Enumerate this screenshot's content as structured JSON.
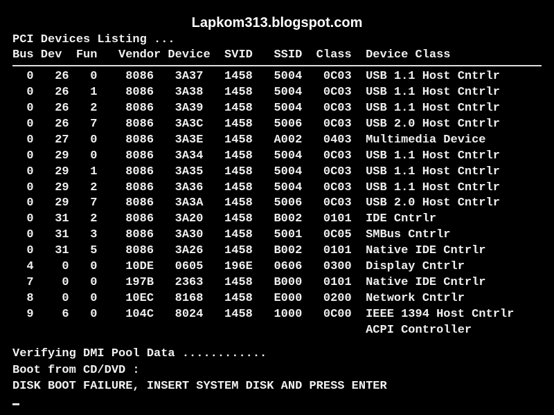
{
  "watermark": "Lapkom313.blogspot.com",
  "title": "PCI Devices Listing ...",
  "headers": {
    "bus": "Bus",
    "dev": "Dev",
    "fun": "Fun",
    "vendor": "Vendor",
    "device": "Device",
    "svid": "SVID",
    "ssid": "SSID",
    "class": "Class",
    "deviceClass": "Device Class"
  },
  "rows": [
    {
      "bus": "0",
      "dev": "26",
      "fun": "0",
      "vendor": "8086",
      "device": "3A37",
      "svid": "1458",
      "ssid": "5004",
      "class": "0C03",
      "deviceClass": "USB 1.1 Host Cntrlr"
    },
    {
      "bus": "0",
      "dev": "26",
      "fun": "1",
      "vendor": "8086",
      "device": "3A38",
      "svid": "1458",
      "ssid": "5004",
      "class": "0C03",
      "deviceClass": "USB 1.1 Host Cntrlr"
    },
    {
      "bus": "0",
      "dev": "26",
      "fun": "2",
      "vendor": "8086",
      "device": "3A39",
      "svid": "1458",
      "ssid": "5004",
      "class": "0C03",
      "deviceClass": "USB 1.1 Host Cntrlr"
    },
    {
      "bus": "0",
      "dev": "26",
      "fun": "7",
      "vendor": "8086",
      "device": "3A3C",
      "svid": "1458",
      "ssid": "5006",
      "class": "0C03",
      "deviceClass": "USB 2.0 Host Cntrlr"
    },
    {
      "bus": "0",
      "dev": "27",
      "fun": "0",
      "vendor": "8086",
      "device": "3A3E",
      "svid": "1458",
      "ssid": "A002",
      "class": "0403",
      "deviceClass": "Multimedia Device"
    },
    {
      "bus": "0",
      "dev": "29",
      "fun": "0",
      "vendor": "8086",
      "device": "3A34",
      "svid": "1458",
      "ssid": "5004",
      "class": "0C03",
      "deviceClass": "USB 1.1 Host Cntrlr"
    },
    {
      "bus": "0",
      "dev": "29",
      "fun": "1",
      "vendor": "8086",
      "device": "3A35",
      "svid": "1458",
      "ssid": "5004",
      "class": "0C03",
      "deviceClass": "USB 1.1 Host Cntrlr"
    },
    {
      "bus": "0",
      "dev": "29",
      "fun": "2",
      "vendor": "8086",
      "device": "3A36",
      "svid": "1458",
      "ssid": "5004",
      "class": "0C03",
      "deviceClass": "USB 1.1 Host Cntrlr"
    },
    {
      "bus": "0",
      "dev": "29",
      "fun": "7",
      "vendor": "8086",
      "device": "3A3A",
      "svid": "1458",
      "ssid": "5006",
      "class": "0C03",
      "deviceClass": "USB 2.0 Host Cntrlr"
    },
    {
      "bus": "0",
      "dev": "31",
      "fun": "2",
      "vendor": "8086",
      "device": "3A20",
      "svid": "1458",
      "ssid": "B002",
      "class": "0101",
      "deviceClass": "IDE Cntrlr"
    },
    {
      "bus": "0",
      "dev": "31",
      "fun": "3",
      "vendor": "8086",
      "device": "3A30",
      "svid": "1458",
      "ssid": "5001",
      "class": "0C05",
      "deviceClass": "SMBus Cntrlr"
    },
    {
      "bus": "0",
      "dev": "31",
      "fun": "5",
      "vendor": "8086",
      "device": "3A26",
      "svid": "1458",
      "ssid": "B002",
      "class": "0101",
      "deviceClass": "Native IDE Cntrlr"
    },
    {
      "bus": "4",
      "dev": "0",
      "fun": "0",
      "vendor": "10DE",
      "device": "0605",
      "svid": "196E",
      "ssid": "0606",
      "class": "0300",
      "deviceClass": "Display Cntrlr"
    },
    {
      "bus": "7",
      "dev": "0",
      "fun": "0",
      "vendor": "197B",
      "device": "2363",
      "svid": "1458",
      "ssid": "B000",
      "class": "0101",
      "deviceClass": "Native IDE Cntrlr"
    },
    {
      "bus": "8",
      "dev": "0",
      "fun": "0",
      "vendor": "10EC",
      "device": "8168",
      "svid": "1458",
      "ssid": "E000",
      "class": "0200",
      "deviceClass": "Network Cntrlr"
    },
    {
      "bus": "9",
      "dev": "6",
      "fun": "0",
      "vendor": "104C",
      "device": "8024",
      "svid": "1458",
      "ssid": "1000",
      "class": "0C00",
      "deviceClass": "IEEE 1394 Host Cntrlr"
    }
  ],
  "acpi": "ACPI Controller",
  "footer": {
    "line1": "Verifying DMI Pool Data ............",
    "line2": "Boot from CD/DVD :",
    "line3": "DISK BOOT FAILURE, INSERT SYSTEM DISK AND PRESS ENTER"
  }
}
